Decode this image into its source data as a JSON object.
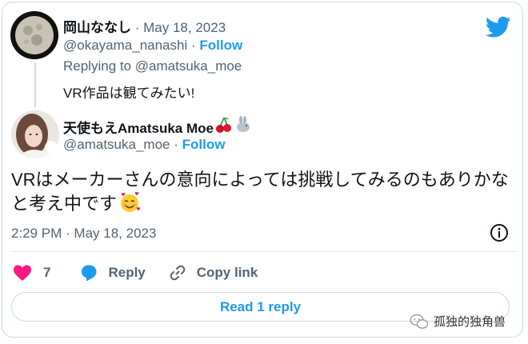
{
  "parent_tweet": {
    "display_name": "岡山ななし",
    "date": "May 18, 2023",
    "handle": "@okayama_nanashi",
    "follow_label": "Follow",
    "replying_to": "Replying to @amatsuka_moe",
    "text": "VR作品は観てみたい!"
  },
  "main_tweet": {
    "display_name": "天使もえAmatsuka Moe",
    "name_emojis": [
      "cherry-icon",
      "rabbit-icon"
    ],
    "handle": "@amatsuka_moe",
    "follow_label": "Follow",
    "text": "VRはメーカーさんの意向によっては挑戦してみるのもありかなと考え中です",
    "text_emoji": "smiling-face-with-hearts-icon",
    "timestamp": "2:29 PM · May 18, 2023",
    "likes_count": "7",
    "reply_label": "Reply",
    "copy_link_label": "Copy link",
    "read_replies_label": "Read 1 reply"
  },
  "watermark": {
    "text": "孤独的独角兽"
  },
  "colors": {
    "accent": "#1d9bf0",
    "like": "#f91880",
    "text": "#0f1419",
    "secondary_text": "#536471",
    "border": "#cfd9de"
  },
  "separators": {
    "dot": "·"
  }
}
